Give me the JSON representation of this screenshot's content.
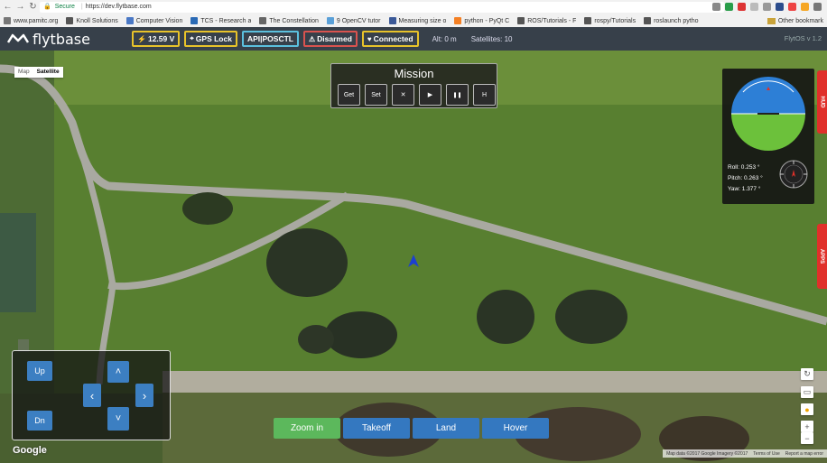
{
  "browser": {
    "secure_label": "Secure",
    "url": "https://dev.flytbase.com",
    "bookmarks": [
      {
        "label": "www.pamitc.org",
        "color": "#777"
      },
      {
        "label": "Knoll Solutions",
        "color": "#555"
      },
      {
        "label": "Computer Vision",
        "color": "#4a78c5"
      },
      {
        "label": "TCS - Research a",
        "color": "#2a6ab5"
      },
      {
        "label": "The Constellation",
        "color": "#666"
      },
      {
        "label": "9 OpenCV tutor",
        "color": "#5aa0d8"
      },
      {
        "label": "Measuring size o",
        "color": "#3b5998"
      },
      {
        "label": "python - PyQt C",
        "color": "#f48024"
      },
      {
        "label": "ROS/Tutorials - F",
        "color": "#555"
      },
      {
        "label": "rospy/Tutorials",
        "color": "#555"
      },
      {
        "label": "roslaunch pytho",
        "color": "#555"
      }
    ],
    "other_bookmarks": "Other bookmark"
  },
  "topbar": {
    "brand": "flytbase",
    "voltage": "12.59 V",
    "gps": "GPS Lock",
    "mode": "API|POSCTL",
    "arm": "Disarmed",
    "link": "Connected",
    "alt": "Alt: 0 m",
    "satellites": "Satellites: 10",
    "version": "FlytOS v 1.2",
    "colors": {
      "voltage": "#e8c32a",
      "gps": "#e8c32a",
      "mode": "#5bc0de",
      "arm": "#d9534f",
      "link": "#e8c32a"
    }
  },
  "map": {
    "type_map": "Map",
    "type_satellite": "Satellite",
    "google": "Google",
    "attribution": [
      "Map data ©2017 Google Imagery ©2017",
      "Terms of Use",
      "Report a map error"
    ]
  },
  "mission": {
    "title": "Mission",
    "buttons": [
      {
        "label": "Get",
        "icon": ""
      },
      {
        "label": "Set",
        "icon": ""
      },
      {
        "label": "",
        "icon": "✕"
      },
      {
        "label": "",
        "icon": "▶"
      },
      {
        "label": "",
        "icon": "❚❚"
      },
      {
        "label": "H",
        "icon": ""
      }
    ]
  },
  "hud": {
    "tab_label": "HUD",
    "roll": "Roll:   0.253 °",
    "pitch": "Pitch:  0.263 °",
    "yaw": "Yaw:    1.377 °"
  },
  "apps": {
    "tab_label": "APPS"
  },
  "joypad": {
    "up": "Up",
    "down": "Dn",
    "fwd": "˄",
    "back": "˅",
    "left": "‹",
    "right": "›"
  },
  "actions": [
    {
      "label": "Zoom in",
      "color": "#5cb85c"
    },
    {
      "label": "Takeoff",
      "color": "#3478c0"
    },
    {
      "label": "Land",
      "color": "#3478c0"
    },
    {
      "label": "Hover",
      "color": "#3478c0"
    }
  ],
  "mapctrl": {
    "zoom_in": "+",
    "zoom_out": "−"
  }
}
